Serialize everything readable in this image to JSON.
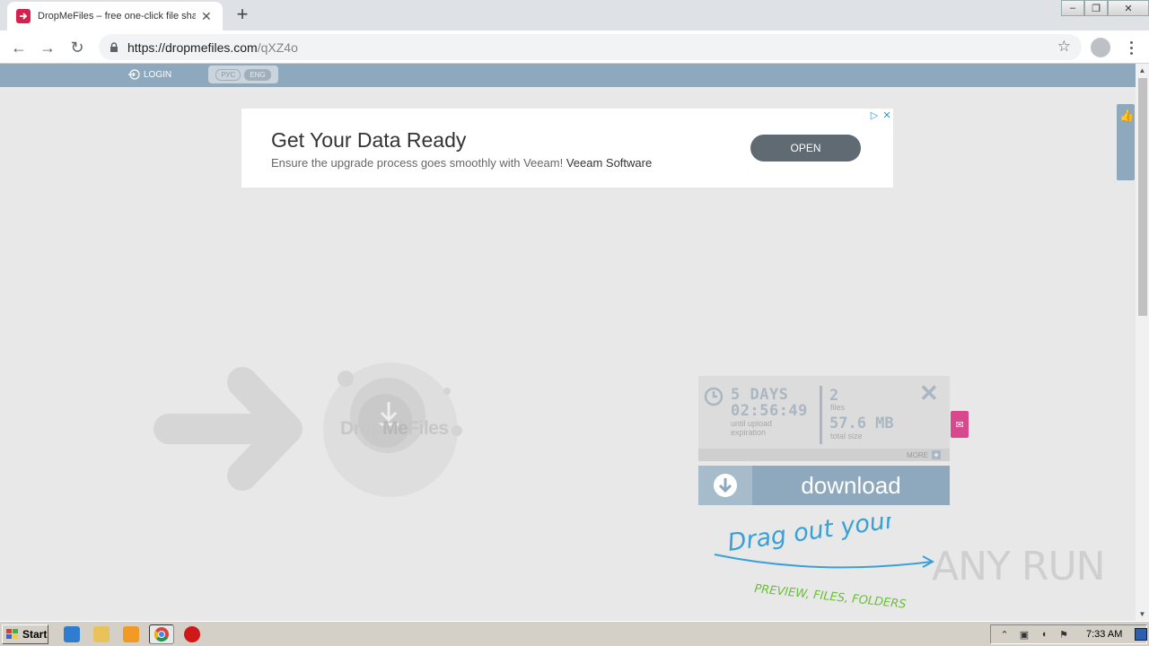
{
  "browser": {
    "tab": {
      "title": "DropMeFiles – free one-click file sharing"
    },
    "address": {
      "host": "https://dropmefiles.com",
      "path": "/qXZ4o"
    }
  },
  "site": {
    "login_label": "LOGIN",
    "lang": [
      "РУС",
      "ENG"
    ],
    "lang_active": "ENG"
  },
  "ad": {
    "title": "Get Your Data Ready",
    "desc": "Ensure the upgrade process goes smoothly with Veeam!",
    "brand": "Veeam Software",
    "button": "OPEN"
  },
  "logo": {
    "part1": "Drop",
    "part2": "Me",
    "part3": "Files"
  },
  "fileinfo": {
    "days": "5 DAYS",
    "time": "02:56:49",
    "expiry_label_1": "until upload",
    "expiry_label_2": "expiration",
    "files_count": "2",
    "files_label": "files",
    "total_size": "57.6 MB",
    "size_label": "total size",
    "more": "MORE"
  },
  "download_label": "download",
  "drag_text": {
    "line1": "Drag out your",
    "line2": "PREVIEW, FILES, FOLDERS"
  },
  "watermark": "ANY RUN",
  "taskbar": {
    "start": "Start",
    "clock": "7:33 AM"
  },
  "colors": {
    "accent": "#8ea9bd",
    "pink": "#d9478c",
    "drag_blue": "#3aa0d8",
    "drag_green": "#6abf3a"
  }
}
